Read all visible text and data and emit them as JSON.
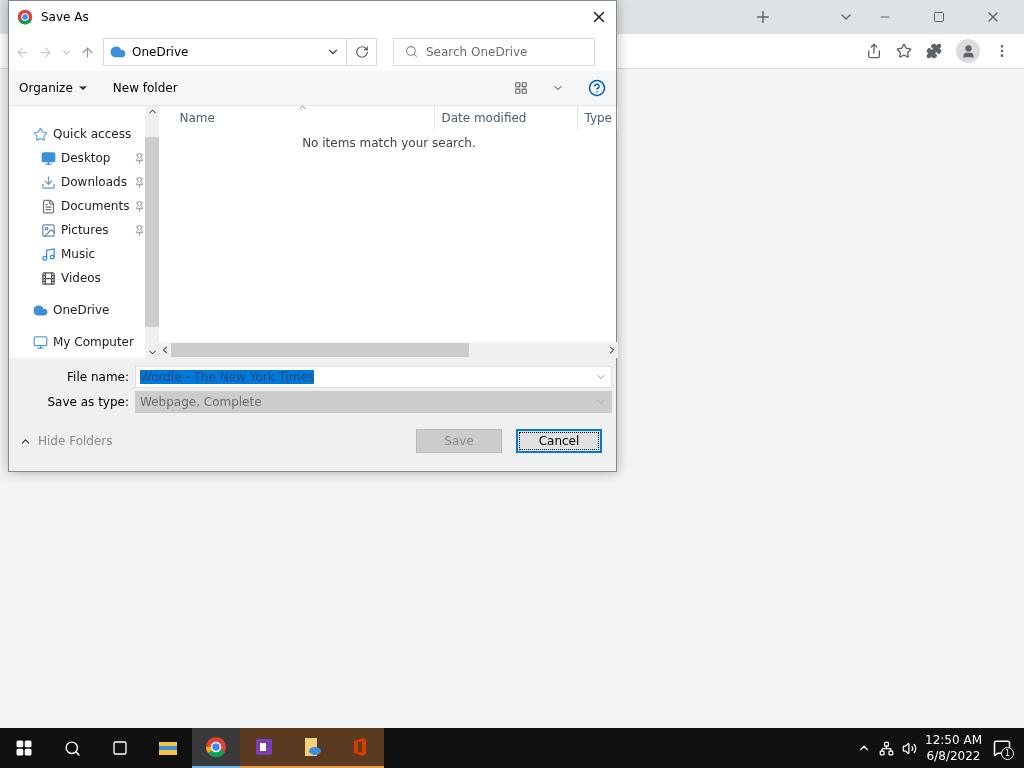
{
  "dialog": {
    "title": "Save As",
    "location": "OneDrive",
    "search": {
      "placeholder": "Search OneDrive"
    },
    "commands": [
      "Organize",
      "New folder"
    ],
    "nav_items": [
      {
        "label": "Quick access",
        "pinned": false,
        "children": [
          {
            "label": "Desktop",
            "pinned": true
          },
          {
            "label": "Downloads",
            "pinned": true
          },
          {
            "label": "Documents",
            "pinned": true
          },
          {
            "label": "Pictures",
            "pinned": true
          },
          {
            "label": "Music",
            "pinned": false
          },
          {
            "label": "Videos",
            "pinned": false
          }
        ]
      },
      {
        "label": "OneDrive",
        "pinned": false
      },
      {
        "label": "My Computer",
        "pinned": false
      }
    ],
    "columns": [
      "Name",
      "Date modified",
      "Type"
    ],
    "empty_message": "No items match your search.",
    "file_name_label": "File name:",
    "file_name": "Wordle - The New York Times",
    "save_type_label": "Save as type:",
    "save_type": "Webpage, Complete",
    "hide_folders": "Hide Folders",
    "buttons": [
      {
        "label": "Save",
        "disabled": true,
        "focused": false
      },
      {
        "label": "Cancel",
        "disabled": false,
        "focused": true
      }
    ]
  },
  "taskbar": {
    "apps": [
      {
        "active": false,
        "open": false
      },
      {
        "active": true,
        "open": true
      },
      {
        "active": false,
        "open": true
      },
      {
        "active": false,
        "open": true
      },
      {
        "active": false,
        "open": true
      }
    ],
    "time": "12:50 AM",
    "date": "6/8/2022",
    "notifications": "1"
  }
}
